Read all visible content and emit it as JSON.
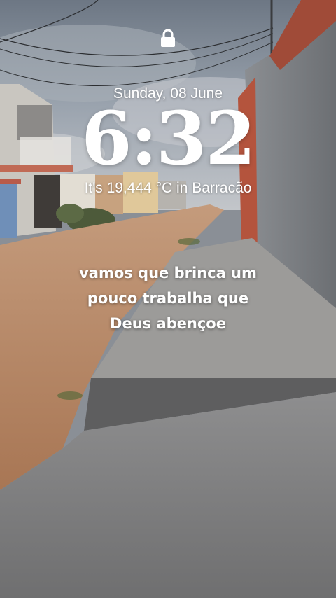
{
  "lockscreen": {
    "date": "Sunday, 08 June",
    "time": "6:32",
    "weather": "It's 19,444 °C in Barracão",
    "message_lines": [
      "vamos que brinca um",
      "pouco trabalha que",
      "Deus abençoe"
    ]
  },
  "icons": {
    "lock": "lock-icon"
  },
  "colors": {
    "text": "#ffffff",
    "sky": "#8d96a3",
    "road_dirt": "#b98a66",
    "pavement": "#7f7f80"
  }
}
